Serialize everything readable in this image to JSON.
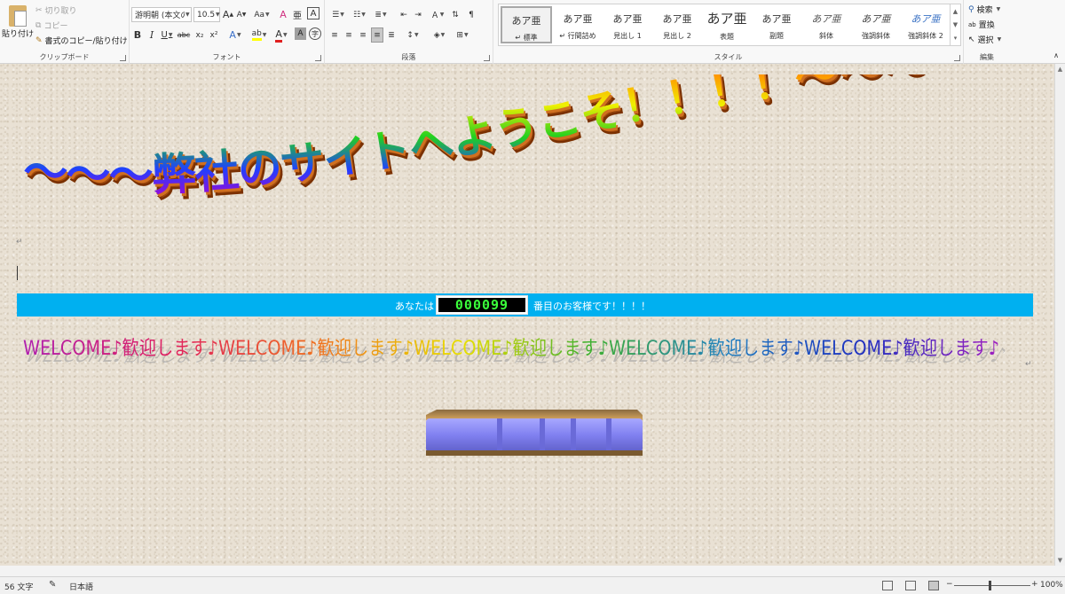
{
  "ribbon": {
    "clipboard": {
      "paste": "貼り付け",
      "cut": "切り取り",
      "copy": "コピー",
      "format_painter": "書式のコピー/貼り付け",
      "label": "クリップボード"
    },
    "font": {
      "font_name": "游明朝 (本文の",
      "font_size": "10.5",
      "grow": "A",
      "shrink": "A",
      "change_case": "Aa",
      "clear": "A",
      "phonetic": "亜",
      "border_char": "A",
      "bold": "B",
      "italic": "I",
      "underline": "U",
      "strike": "abc",
      "subscript": "x₂",
      "superscript": "x²",
      "text_effect": "A",
      "highlight": "ab",
      "font_color": "A",
      "shading": "A",
      "enclose": "字",
      "label": "フォント"
    },
    "paragraph": {
      "label": "段落"
    },
    "styles": {
      "label": "スタイル",
      "items": [
        {
          "sample": "あア亜",
          "name": "↵ 標準"
        },
        {
          "sample": "あア亜",
          "name": "↵ 行間詰め"
        },
        {
          "sample": "あア亜",
          "name": "見出し 1"
        },
        {
          "sample": "あア亜",
          "name": "見出し 2"
        },
        {
          "sample": "あア亜",
          "name": "表題"
        },
        {
          "sample": "あア亜",
          "name": "副題"
        },
        {
          "sample": "あア亜",
          "name": "斜体"
        },
        {
          "sample": "あア亜",
          "name": "強調斜体"
        },
        {
          "sample": "あア亜",
          "name": "強調斜体 2"
        }
      ]
    },
    "editing": {
      "find": "検索",
      "replace": "置換",
      "select": "選択",
      "label": "編集"
    }
  },
  "document": {
    "title": "～～～弊社のサイトへようこそ！！！！～～～",
    "counter_prefix": "あなたは",
    "counter_value": "000099",
    "counter_suffix": "番目のお客様です！！！！",
    "welcome_line": "WELCOME♪歓迎します♪WELCOME♪歓迎します♪WELCOME♪歓迎します♪WELCOME♪歓迎します♪WELCOME♪歓迎します♪",
    "colors": {
      "counter_bar": "#00b0f0",
      "counter_digits": "#3aff3a",
      "plate": "#8c8cff"
    }
  },
  "status": {
    "word_count": "56 文字",
    "language": "日本語",
    "zoom": "100%"
  }
}
